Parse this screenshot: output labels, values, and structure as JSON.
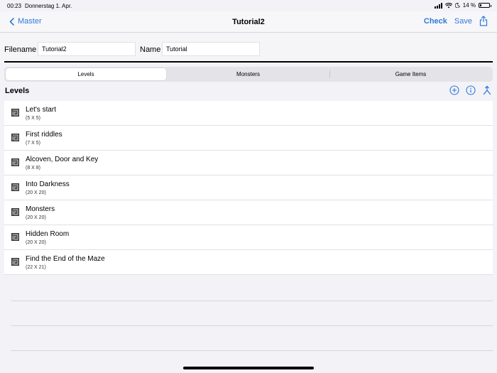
{
  "status": {
    "time": "00:23",
    "date": "Donnerstag 1. Apr.",
    "battery": "14 %",
    "battery_level": 0.14
  },
  "nav": {
    "back_label": "Master",
    "title": "Tutorial2",
    "check_label": "Check",
    "save_label": "Save"
  },
  "form": {
    "filename_label": "Filename",
    "filename_value": "Tutorial2",
    "name_label": "Name",
    "name_value": "Tutorial"
  },
  "tabs": [
    {
      "label": "Levels",
      "active": true
    },
    {
      "label": "Monsters",
      "active": false
    },
    {
      "label": "Game Items",
      "active": false
    }
  ],
  "section": {
    "title": "Levels",
    "icons": [
      "add-circle-icon",
      "info-icon",
      "merge-icon"
    ]
  },
  "levels": [
    {
      "title": "Let's start",
      "size": "(5 X 5)"
    },
    {
      "title": "First riddles",
      "size": "(7 X 5)"
    },
    {
      "title": "Alcoven, Door and Key",
      "size": "(8 X 8)"
    },
    {
      "title": "Into Darkness",
      "size": "(20 X 20)"
    },
    {
      "title": "Monsters",
      "size": "(20 X 20)"
    },
    {
      "title": "Hidden Room",
      "size": "(20 X 20)"
    },
    {
      "title": "Find the End of the Maze",
      "size": "(22 X 21)"
    }
  ],
  "colors": {
    "accent": "#2f7ad8",
    "background": "#f2f2f7"
  }
}
